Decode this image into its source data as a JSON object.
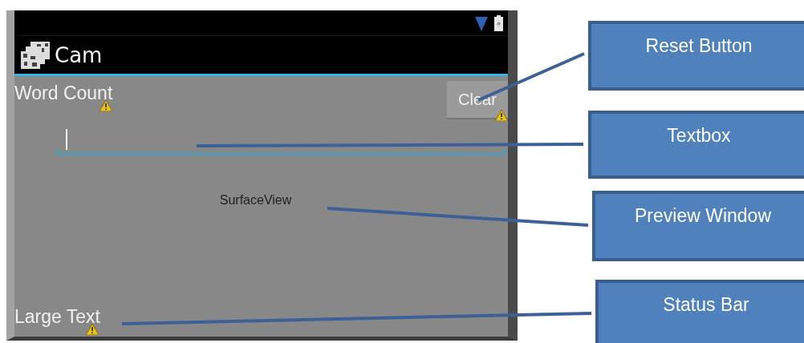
{
  "phone": {
    "app_title": "Cam",
    "word_count_label": "Word Count",
    "clear_button": "Clear",
    "text_field": {
      "focused": true
    },
    "surface_label": "SurfaceView",
    "large_text": "Large Text"
  },
  "callouts": [
    {
      "label": "Reset Button"
    },
    {
      "label": "Textbox"
    },
    {
      "label": "Preview Window"
    },
    {
      "label": "Status Bar"
    }
  ]
}
